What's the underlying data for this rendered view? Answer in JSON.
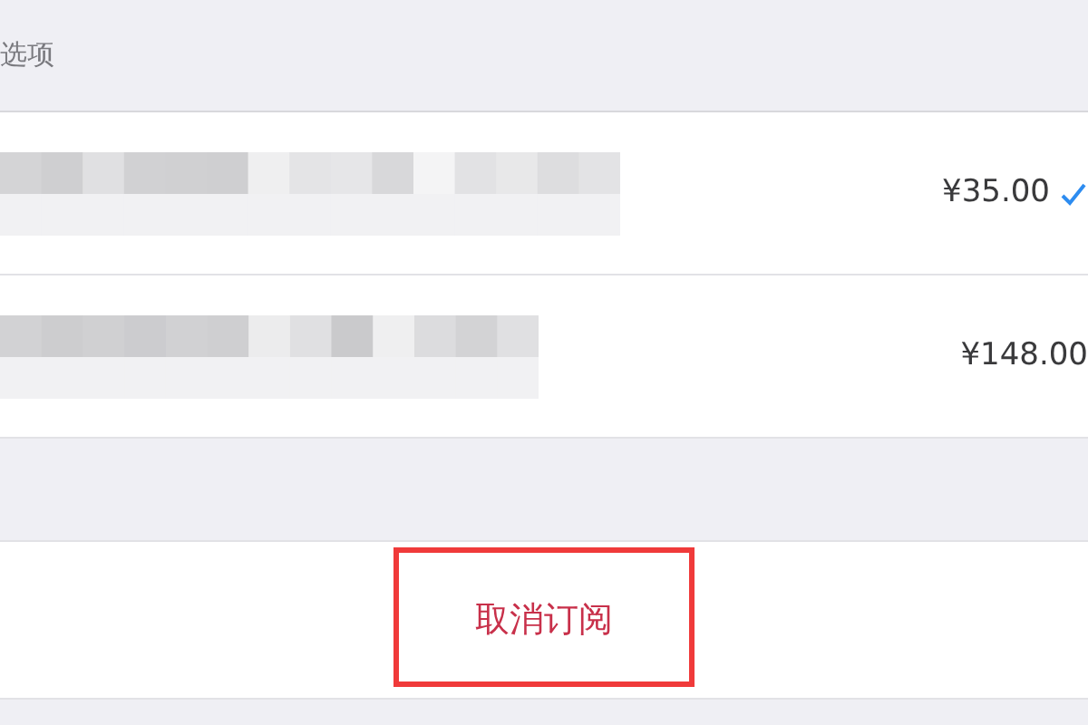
{
  "section_header": "选项",
  "options": [
    {
      "price": "¥35.00",
      "selected": true
    },
    {
      "price": "¥148.00",
      "selected": false
    }
  ],
  "cancel_button": "取消订阅"
}
